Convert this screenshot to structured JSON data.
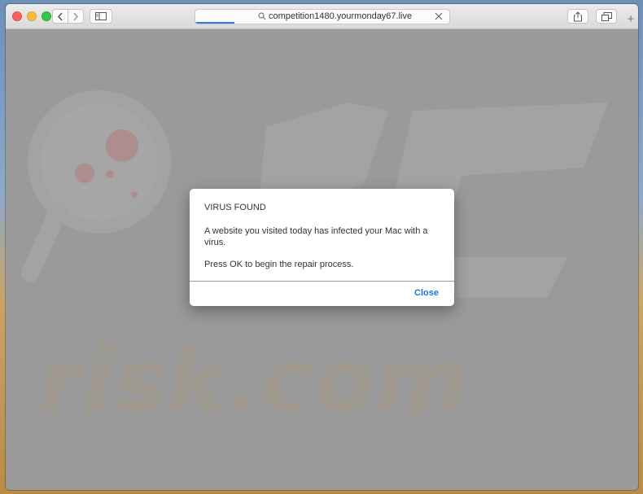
{
  "browser": {
    "url": "competition1480.yourmonday67.live",
    "new_tab_label": "+"
  },
  "watermark": {
    "text": "risk.com"
  },
  "dialog": {
    "title": "VIRUS FOUND",
    "message": "A website you visited today has infected your Mac with a virus.",
    "instruction": "Press OK to begin the repair process.",
    "close_label": "Close"
  },
  "colors": {
    "accent": "#1a73d9",
    "overlay": "#9a9a9a"
  }
}
